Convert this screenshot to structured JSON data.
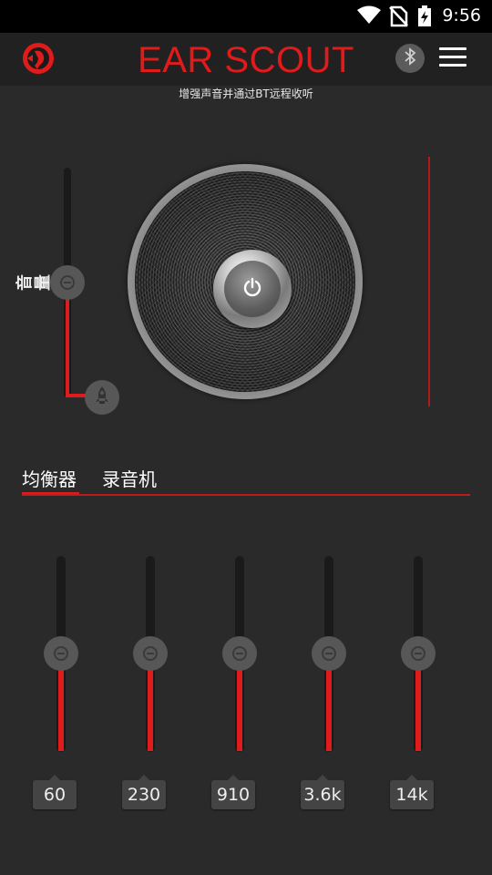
{
  "status_bar": {
    "time": "9:56",
    "icons": [
      "wifi-icon",
      "no-sim-icon",
      "battery-charging-icon"
    ]
  },
  "header": {
    "title": "EAR SCOUT",
    "subtitle": "增强声音并通过BT远程收听",
    "logo_icon": "ear-scout-logo-icon",
    "bluetooth_icon": "bluetooth-icon",
    "menu_icon": "hamburger-menu-icon"
  },
  "volume": {
    "label": "音量",
    "level": 0.5,
    "boost_icon": "rocket-icon"
  },
  "power": {
    "icon": "power-icon"
  },
  "tabs": [
    {
      "label": "均衡器",
      "active": true
    },
    {
      "label": "录音机",
      "active": false
    }
  ],
  "equalizer": {
    "bands": [
      {
        "label": "60",
        "level": 0.5
      },
      {
        "label": "230",
        "level": 0.5
      },
      {
        "label": "910",
        "level": 0.5
      },
      {
        "label": "3.6k",
        "level": 0.5
      },
      {
        "label": "14k",
        "level": 0.5
      }
    ]
  },
  "colors": {
    "accent": "#e01b1b",
    "background": "#2a2a2a",
    "header_bg": "#212121",
    "knob": "#575757"
  }
}
